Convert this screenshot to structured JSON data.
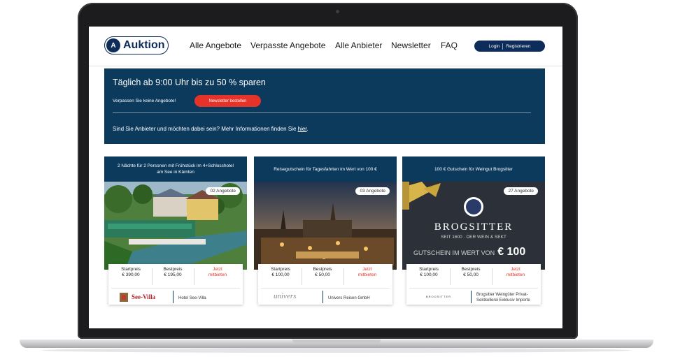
{
  "nav": {
    "brand": "Auktion",
    "links": [
      "Alle Angebote",
      "Verpasste Angebote",
      "Alle Anbieter",
      "Newsletter",
      "FAQ"
    ],
    "login": "Login",
    "register": "Registrieren"
  },
  "hero": {
    "title": "Täglich ab 9:00 Uhr bis zu 50 % sparen",
    "subtitle": "Verpassen Sie keine Angebote!",
    "newsletter_button": "Newsletter bestellen",
    "info_text": "Sind Sie Anbieter und möchten dabei sein? Mehr Informationen finden Sie ",
    "info_link": "hier",
    "info_end": "."
  },
  "cards": [
    {
      "title": "2 Nächte für 2 Personen mit Frühstück im 4+Schlosshotel am See in Kärnten",
      "count": "02 Angebote",
      "start_label": "Startpreis",
      "start_value": "€ 390,00",
      "best_label": "Bestpreis",
      "best_value": "€ 195,00",
      "bid_line1": "Jetzt",
      "bid_line2": "mitbieten",
      "provider_logo": "See-Villa",
      "provider": "Hotel See-Villa"
    },
    {
      "title": "Reisegutschein für Tagesfahrten im Wert von 100 €",
      "count": "03 Angebote",
      "start_label": "Startpreis",
      "start_value": "€ 100,00",
      "best_label": "Bestpreis",
      "best_value": "€ 50,00",
      "bid_line1": "Jetzt",
      "bid_line2": "mitbieten",
      "provider_logo": "univers",
      "provider": "Univers Reisen GmbH"
    },
    {
      "title": "100 € Gutschein für Weingut Brogsitter",
      "count": "27 Angebote",
      "start_label": "Startpreis",
      "start_value": "€ 100,00",
      "best_label": "Bestpreis",
      "best_value": "€ 50,00",
      "bid_line1": "Jetzt",
      "bid_line2": "mitbieten",
      "provider_logo": "BROGSITTER",
      "provider_line1": "Brogsitter Weingüter Privat-",
      "provider_line2": "Sektkellerei Exklusiv Importe",
      "voucher": {
        "brand": "BROGSITTER",
        "since": "SEIT 1600 · DER WEIN & SEKT",
        "value_text": "GUTSCHEIN IM WERT VON",
        "value": "€ 100"
      }
    }
  ],
  "colors": {
    "navy": "#0b3a5d",
    "red": "#e63329",
    "brand": "#0d2c5a"
  },
  "icons": [
    "auktion-logo-icon",
    "hotel-crest-icon",
    "ribbon-bow-icon",
    "brogsitter-crest-icon"
  ]
}
